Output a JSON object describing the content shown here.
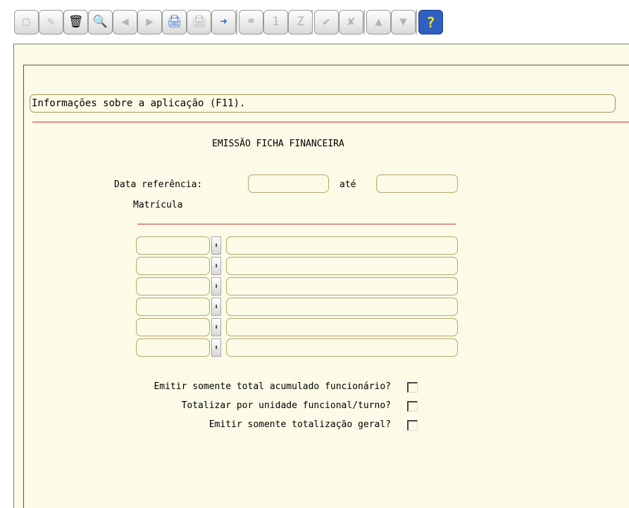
{
  "toolbar": {
    "buttons": [
      {
        "name": "new-record-button",
        "icon": "new-document-icon",
        "glyph": "▢",
        "state": "disabled"
      },
      {
        "name": "edit-button",
        "icon": "pencil-icon",
        "glyph": "✎",
        "state": "disabled"
      },
      {
        "name": "delete-button",
        "icon": "trash-icon",
        "glyph": "🗑",
        "state": "normal"
      },
      {
        "name": "search-button",
        "icon": "magnifier-icon",
        "glyph": "🔍",
        "state": "normal"
      },
      {
        "name": "previous-button",
        "icon": "circle-left-icon",
        "glyph": "◀",
        "state": "disabled"
      },
      {
        "name": "next-button",
        "icon": "circle-right-icon",
        "glyph": "▶",
        "state": "disabled"
      },
      {
        "name": "print-button",
        "icon": "printer-icon",
        "glyph": "🖨",
        "state": "active"
      },
      {
        "name": "print-preview-button",
        "icon": "printer-gray-icon",
        "glyph": "🖨",
        "state": "disabled"
      },
      {
        "name": "exit-button",
        "icon": "exit-door-icon",
        "glyph": "➜",
        "state": "active"
      },
      {
        "name": "binoculars-button",
        "icon": "binoculars-icon",
        "glyph": "⚭",
        "state": "disabled"
      },
      {
        "name": "first-page-button",
        "icon": "page-one-icon",
        "glyph": "1",
        "state": "disabled"
      },
      {
        "name": "last-page-button",
        "icon": "page-z-icon",
        "glyph": "Z",
        "state": "disabled"
      },
      {
        "name": "confirm-button",
        "icon": "checkmark-icon",
        "glyph": "✔",
        "state": "disabled"
      },
      {
        "name": "cancel-button",
        "icon": "scissors-x-icon",
        "glyph": "✘",
        "state": "disabled"
      },
      {
        "name": "up-button",
        "icon": "triangle-up-icon",
        "glyph": "▲",
        "state": "disabled"
      },
      {
        "name": "down-button",
        "icon": "triangle-down-icon",
        "glyph": "▼",
        "state": "disabled"
      },
      {
        "name": "help-button",
        "icon": "question-mark-icon",
        "glyph": "?",
        "state": "help"
      }
    ]
  },
  "status": {
    "message": "Informações sobre a aplicação (F11)."
  },
  "form": {
    "title": "EMISSÃO FICHA FINANCEIRA",
    "date_label": "Data referência:",
    "date_from": "",
    "until_label": "até",
    "date_to": "",
    "registration_label": "Matrícula",
    "rows": [
      {
        "code": "",
        "name": ""
      },
      {
        "code": "",
        "name": ""
      },
      {
        "code": "",
        "name": ""
      },
      {
        "code": "",
        "name": ""
      },
      {
        "code": "",
        "name": ""
      },
      {
        "code": "",
        "name": ""
      }
    ],
    "options": [
      {
        "label": "Emitir somente total acumulado funcionário?",
        "checked": false
      },
      {
        "label": "Totalizar por unidade funcional/turno?",
        "checked": false
      },
      {
        "label": "Emitir somente totalização geral?",
        "checked": false
      }
    ]
  },
  "colors": {
    "background": "#fbfbe7",
    "field_border": "#b9a56b",
    "separator": "#d0302a"
  }
}
